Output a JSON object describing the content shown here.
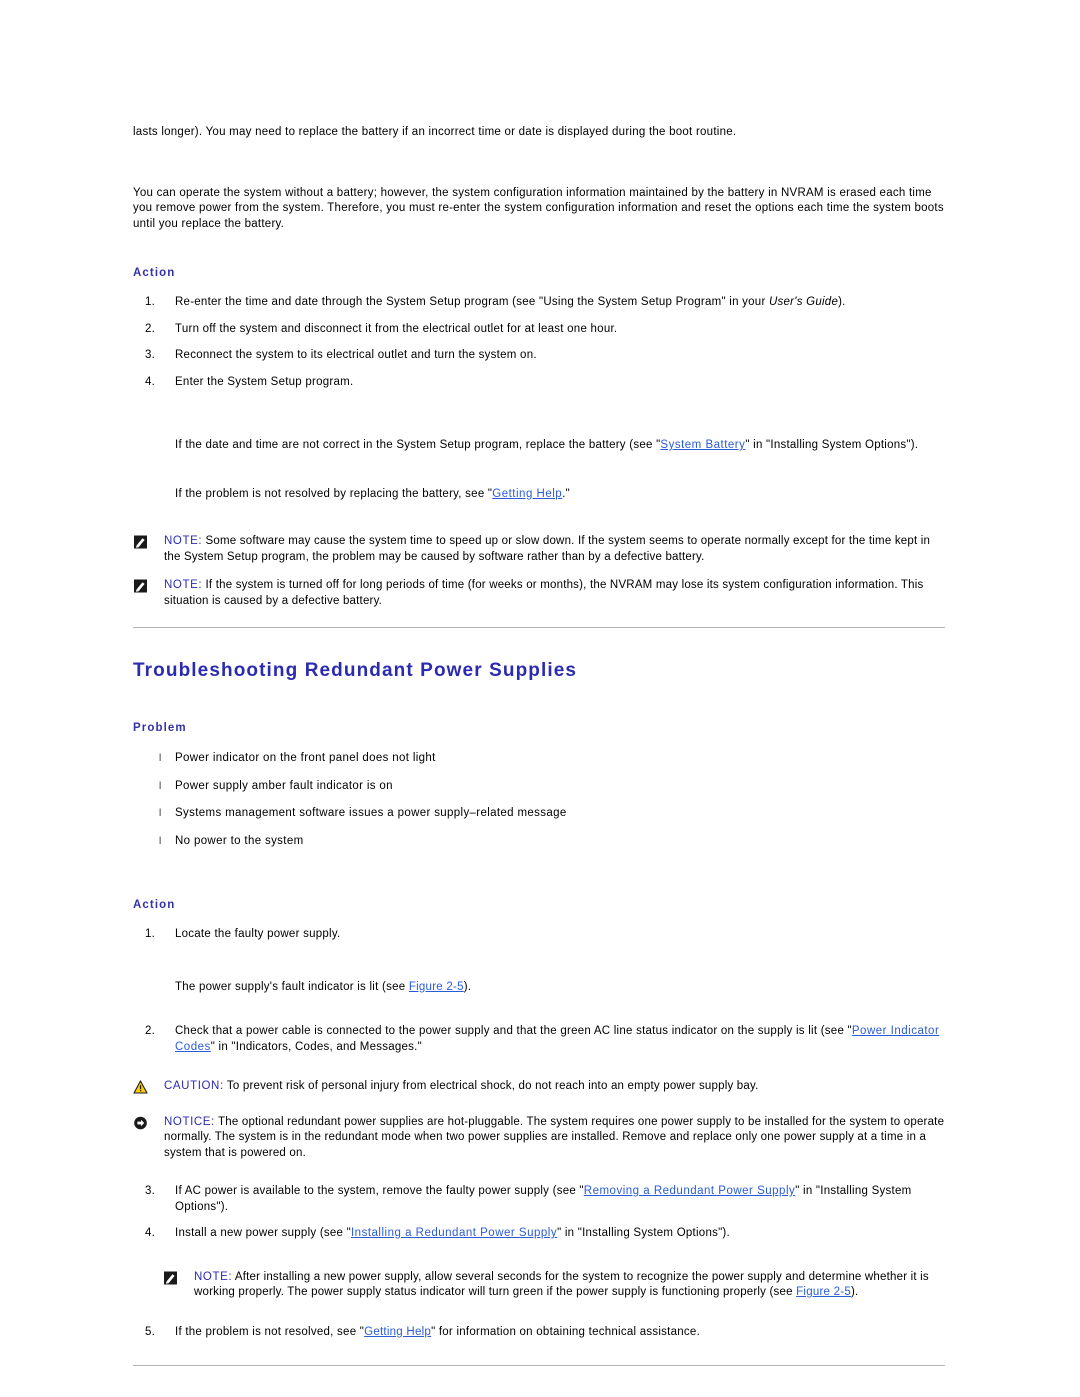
{
  "document": {
    "intro_paragraph_1": "lasts longer). You may need to replace the battery if an incorrect time or date is displayed during the boot routine.",
    "intro_paragraph_2": "You can operate the system without a battery; however, the system configuration information maintained by the battery in NVRAM is erased each time you remove power from the system. Therefore, you must re-enter the system configuration information and reset the options each time the system boots until you replace the battery."
  },
  "battery_action": {
    "heading": "Action",
    "steps": [
      {
        "number": "1.",
        "text_before": "Re-enter the time and date through the System Setup program (see \"Using the System Setup Program\" in your ",
        "italic": "User's Guide",
        "text_after": ")."
      },
      {
        "number": "2.",
        "text_before": "Turn off the system and disconnect it from the electrical outlet for at least one hour.",
        "italic": "",
        "text_after": ""
      },
      {
        "number": "3.",
        "text_before": "Reconnect the system to its electrical outlet and turn the system on.",
        "italic": "",
        "text_after": ""
      },
      {
        "number": "4.",
        "text_before": "Enter the System Setup program.",
        "italic": "",
        "text_after": ""
      }
    ],
    "followup_1_before": "If the date and time are not correct in the System Setup program, replace the battery (see \"",
    "followup_1_link": "System Battery",
    "followup_1_after": "\" in \"Installing System Options\").",
    "followup_2_before": "If the problem is not resolved by replacing the battery, see \"",
    "followup_2_link": "Getting Help",
    "followup_2_after": ".\""
  },
  "battery_notes": [
    {
      "icon": "note-pencil-icon",
      "label": "NOTE:",
      "text": " Some software may cause the system time to speed up or slow down. If the system seems to operate normally except for the time kept in the System Setup program, the problem may be caused by software rather than by a defective battery."
    },
    {
      "icon": "note-pencil-icon",
      "label": "NOTE:",
      "text": " If the system is turned off for long periods of time (for weeks or months), the NVRAM may lose its system configuration information. This situation is caused by a defective battery."
    }
  ],
  "power_section": {
    "heading": "Troubleshooting Redundant Power Supplies",
    "problem_heading": "Problem",
    "problems": [
      "Power indicator on the front panel does not light",
      "Power supply amber fault indicator is on",
      "Systems management software issues a power supply–related message",
      "No power to the system"
    ],
    "action_heading": "Action",
    "step_1_number": "1.",
    "step_1_text": "Locate the faulty power supply.",
    "fault_indicator_before": "The power supply's fault indicator is lit (see ",
    "fault_indicator_link": "Figure 2-5",
    "fault_indicator_after": ").",
    "step_2_number": "2.",
    "step_2_before": "Check that a power cable is connected to the power supply and that the green AC line status indicator on the supply is lit (see \"",
    "step_2_link": "Power Indicator Codes",
    "step_2_after": "\" in \"Indicators, Codes, and Messages.\"",
    "caution": {
      "icon": "warning-triangle-icon",
      "label": "CAUTION:",
      "text": " To prevent risk of personal injury from electrical shock, do not reach into an empty power supply bay."
    },
    "notice": {
      "icon": "notice-arrow-icon",
      "label": "NOTICE:",
      "text": " The optional redundant power supplies are hot-pluggable. The system requires one power supply to be installed for the system to operate normally. The system is in the redundant mode when two power supplies are installed. Remove and replace only one power supply at a time in a system that is powered on."
    },
    "step_3_number": "3.",
    "step_3_before": "If AC power is available to the system, remove the faulty power supply (see \"",
    "step_3_link": "Removing a Redundant Power Supply",
    "step_3_after": "\" in \"Installing System Options\").",
    "step_4_number": "4.",
    "step_4_before": "Install a new power supply (see \"",
    "step_4_link": "Installing a Redundant Power Supply",
    "step_4_after": "\" in \"Installing System Options\").",
    "note": {
      "icon": "note-pencil-icon",
      "label": "NOTE:",
      "text_before": " After installing a new power supply, allow several seconds for the system to recognize the power supply and determine whether it is working properly. The power supply status indicator will turn green if the power supply is functioning properly (see ",
      "link": "Figure 2-5",
      "text_after": ")."
    },
    "step_5_number": "5.",
    "step_5_before": "If the problem is not resolved, see \"",
    "step_5_link": "Getting Help",
    "step_5_after": "\" for information on obtaining technical assistance."
  },
  "icons": {
    "bullet_glyph": "l"
  },
  "colors": {
    "heading_blue": "#2b2bb0",
    "subheading_blue": "#3333a8",
    "link_blue": "#2a5bd7",
    "rule_gray": "#b3b3b3",
    "caution_yellow": "#ffcc00",
    "body_black": "#000000"
  }
}
